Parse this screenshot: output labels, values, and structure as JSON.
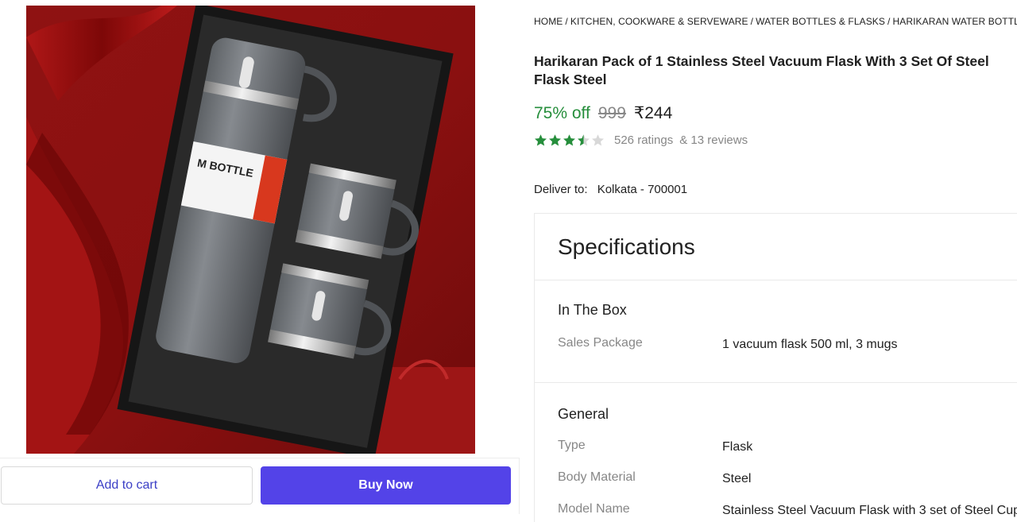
{
  "actions": {
    "add_to_cart": "Add to cart",
    "buy_now": "Buy Now"
  },
  "breadcrumb": [
    "HOME",
    "KITCHEN, COOKWARE & SERVEWARE",
    "WATER BOTTLES & FLASKS",
    "HARIKARAN WATER BOTTLES &"
  ],
  "product": {
    "title_line1": "Harikaran Pack of 1 Stainless Steel Vacuum Flask With 3 Set Of Steel",
    "title_line2": "Flask Steel",
    "bottle_label": "M BOTTLE"
  },
  "pricing": {
    "discount": "75% off",
    "mrp": "999",
    "price": "₹244"
  },
  "rating": {
    "value": 3.5,
    "max": 5,
    "ratings_text": "526 ratings",
    "reviews_text": "& 13 reviews",
    "star_color": "#268e3c",
    "empty_star_color": "#d8d8d8"
  },
  "delivery": {
    "label": "Deliver to:",
    "location": "Kolkata - 700001"
  },
  "specifications": {
    "heading": "Specifications",
    "sections": [
      {
        "title": "In The Box",
        "rows": [
          {
            "key": "Sales Package",
            "value": "1 vacuum flask 500 ml, 3 mugs"
          }
        ]
      },
      {
        "title": "General",
        "rows": [
          {
            "key": "Type",
            "value": "Flask"
          },
          {
            "key": "Body Material",
            "value": "Steel"
          },
          {
            "key": "Model Name",
            "value": "Stainless Steel Vacuum Flask with 3 set of Steel Cup"
          }
        ]
      }
    ]
  },
  "colors": {
    "accent": "#5343e8",
    "discount_green": "#268e3c",
    "muted": "#878787"
  }
}
